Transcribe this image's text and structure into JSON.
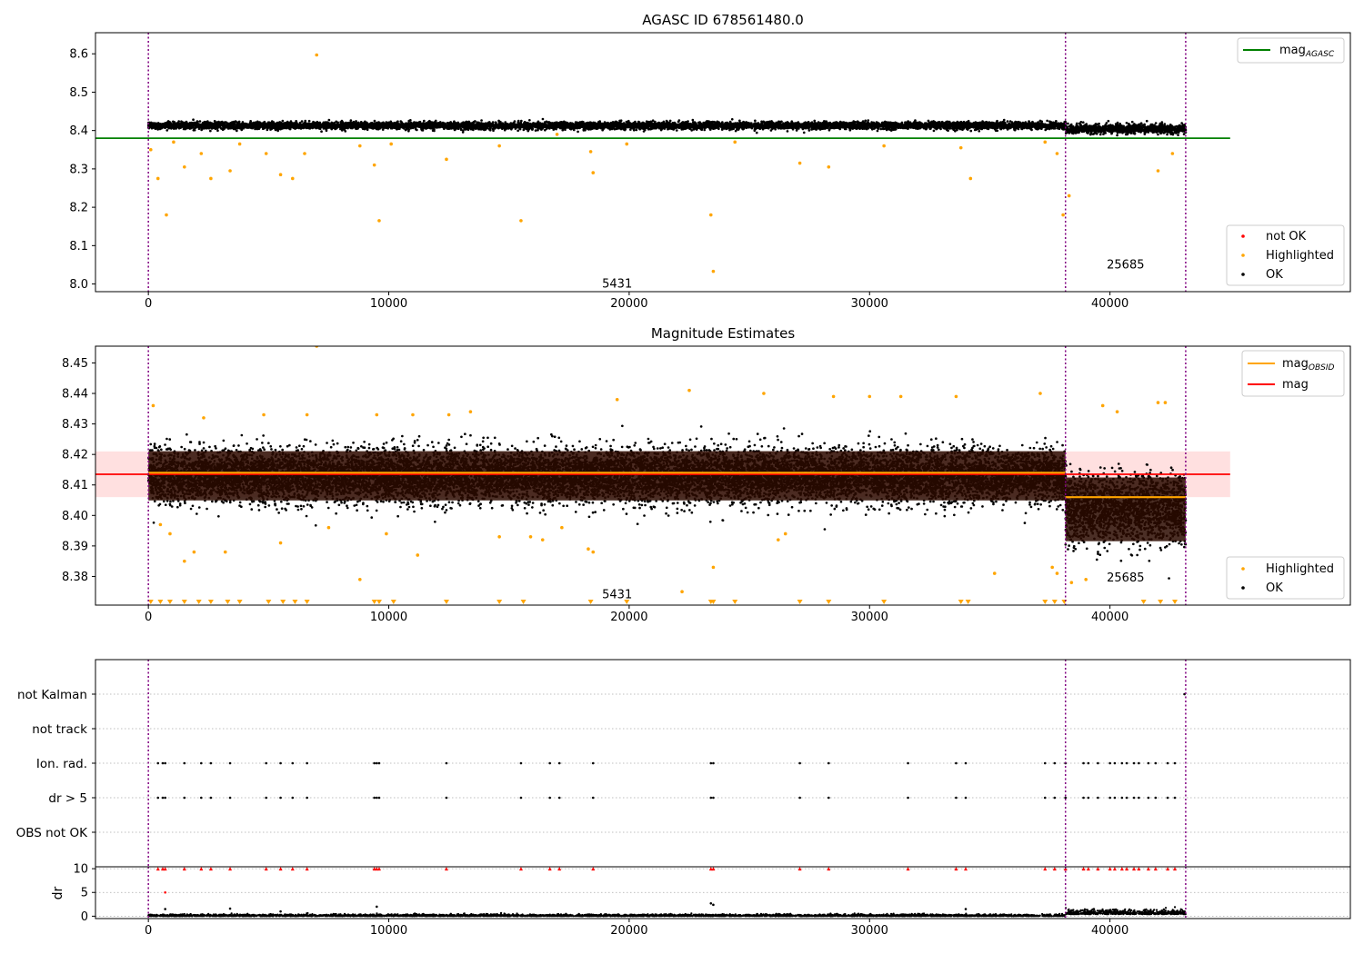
{
  "figure": {
    "x_ticks": [
      "0",
      "10000",
      "20000",
      "30000",
      "40000"
    ]
  },
  "chart_data": [
    {
      "type": "scatter",
      "title": "AGASC ID 678561480.0",
      "xlim": [
        -2200,
        50000
      ],
      "ylim": [
        7.98,
        8.655
      ],
      "y_ticks": [
        "8.0",
        "8.1",
        "8.2",
        "8.3",
        "8.4",
        "8.5",
        "8.6"
      ],
      "vlines": [
        0,
        38150,
        43150
      ],
      "segment_labels": [
        {
          "text": "5431",
          "x": 19500,
          "y": 8.0
        },
        {
          "text": "25685",
          "x": 40650,
          "y": 8.05
        }
      ],
      "mag_agasc": 8.38,
      "mag_agasc_xrange": [
        -2200,
        45000
      ],
      "band": {
        "segments": [
          {
            "x0": 0,
            "x1": 38150,
            "y_mean": 8.413,
            "spread": 0.009
          },
          {
            "x0": 38150,
            "x1": 43150,
            "y_mean": 8.404,
            "spread": 0.011
          }
        ]
      },
      "highlighted": [
        [
          100,
          8.35
        ],
        [
          400,
          8.275
        ],
        [
          750,
          8.18
        ],
        [
          1050,
          8.37
        ],
        [
          1500,
          8.305
        ],
        [
          2200,
          8.34
        ],
        [
          2600,
          8.275
        ],
        [
          3400,
          8.295
        ],
        [
          3800,
          8.365
        ],
        [
          4900,
          8.34
        ],
        [
          5500,
          8.285
        ],
        [
          6000,
          8.275
        ],
        [
          6500,
          8.34
        ],
        [
          7000,
          8.597
        ],
        [
          8800,
          8.36
        ],
        [
          9400,
          8.31
        ],
        [
          9600,
          8.165
        ],
        [
          10100,
          8.365
        ],
        [
          12400,
          8.325
        ],
        [
          14600,
          8.36
        ],
        [
          15500,
          8.165
        ],
        [
          17000,
          8.39
        ],
        [
          18400,
          8.345
        ],
        [
          18500,
          8.29
        ],
        [
          19900,
          8.365
        ],
        [
          23400,
          8.18
        ],
        [
          23500,
          8.033
        ],
        [
          24400,
          8.37
        ],
        [
          27100,
          8.315
        ],
        [
          28300,
          8.305
        ],
        [
          30600,
          8.36
        ],
        [
          33800,
          8.355
        ],
        [
          34200,
          8.275
        ],
        [
          37300,
          8.37
        ],
        [
          37800,
          8.34
        ],
        [
          38050,
          8.18
        ],
        [
          38300,
          8.23
        ],
        [
          42000,
          8.295
        ],
        [
          42600,
          8.34
        ]
      ],
      "legend_lines": [
        {
          "label": "mag",
          "sub": "AGASC",
          "color": "#008000"
        }
      ],
      "legend_points": [
        {
          "label": "not OK",
          "color": "#ff0000"
        },
        {
          "label": "Highlighted",
          "color": "#ffa500"
        },
        {
          "label": "OK",
          "color": "#000000"
        }
      ]
    },
    {
      "type": "scatter",
      "title": "Magnitude Estimates",
      "xlim": [
        -2200,
        50000
      ],
      "ylim": [
        8.3706,
        8.4555
      ],
      "y_ticks": [
        "8.38",
        "8.39",
        "8.40",
        "8.41",
        "8.42",
        "8.43",
        "8.44",
        "8.45"
      ],
      "vlines": [
        0,
        38150,
        43150
      ],
      "segment_labels": [
        {
          "text": "5431",
          "x": 19500,
          "y": 8.374
        },
        {
          "text": "25685",
          "x": 40650,
          "y": 8.3795
        }
      ],
      "mag": 8.4135,
      "mag_band": [
        8.406,
        8.421
      ],
      "mag_xrange": [
        -2200,
        45000
      ],
      "mag_obsid": [
        {
          "x0": 0,
          "x1": 38150,
          "y": 8.414
        },
        {
          "x0": 38150,
          "x1": 43150,
          "y": 8.406
        }
      ],
      "band": {
        "segments": [
          {
            "x0": 0,
            "x1": 38150,
            "y_mean": 8.413,
            "spread": 0.0085
          },
          {
            "x0": 38150,
            "x1": 43150,
            "y_mean": 8.402,
            "spread": 0.011
          }
        ]
      },
      "highlighted": [
        [
          200,
          8.436
        ],
        [
          500,
          8.397
        ],
        [
          900,
          8.394
        ],
        [
          1500,
          8.385
        ],
        [
          1900,
          8.388
        ],
        [
          2300,
          8.432
        ],
        [
          3200,
          8.388
        ],
        [
          4800,
          8.433
        ],
        [
          5500,
          8.391
        ],
        [
          6600,
          8.433
        ],
        [
          7000,
          8.4555
        ],
        [
          7500,
          8.396
        ],
        [
          8800,
          8.379
        ],
        [
          9500,
          8.433
        ],
        [
          9900,
          8.394
        ],
        [
          11000,
          8.433
        ],
        [
          11200,
          8.387
        ],
        [
          12500,
          8.433
        ],
        [
          13400,
          8.434
        ],
        [
          14600,
          8.393
        ],
        [
          15900,
          8.393
        ],
        [
          16400,
          8.392
        ],
        [
          17200,
          8.396
        ],
        [
          18300,
          8.389
        ],
        [
          18500,
          8.388
        ],
        [
          19500,
          8.438
        ],
        [
          22200,
          8.375
        ],
        [
          22500,
          8.441
        ],
        [
          23500,
          8.383
        ],
        [
          25600,
          8.44
        ],
        [
          26200,
          8.392
        ],
        [
          26500,
          8.394
        ],
        [
          28500,
          8.439
        ],
        [
          30000,
          8.439
        ],
        [
          31300,
          8.439
        ],
        [
          33600,
          8.439
        ],
        [
          35200,
          8.381
        ],
        [
          37100,
          8.44
        ],
        [
          37600,
          8.383
        ],
        [
          37800,
          8.381
        ],
        [
          38400,
          8.378
        ],
        [
          39000,
          8.379
        ],
        [
          39700,
          8.436
        ],
        [
          40300,
          8.434
        ],
        [
          42000,
          8.437
        ],
        [
          42300,
          8.437
        ]
      ],
      "off_scale_low": [
        100,
        500,
        900,
        1500,
        2100,
        2600,
        3300,
        3800,
        5000,
        5600,
        6100,
        6600,
        9400,
        9600,
        10200,
        12400,
        14600,
        15600,
        18400,
        19900,
        23400,
        23500,
        24400,
        27100,
        28300,
        30600,
        33800,
        34100,
        37300,
        37700,
        38100,
        41400,
        42100,
        42700
      ],
      "legend_lines": [
        {
          "label": "mag",
          "sub": "OBSID",
          "color": "#ffa500"
        },
        {
          "label": "mag",
          "sub": "",
          "color": "#ff0000"
        }
      ],
      "legend_points": [
        {
          "label": "Highlighted",
          "color": "#ffa500"
        },
        {
          "label": "OK",
          "color": "#000000"
        }
      ]
    },
    {
      "type": "scatter",
      "title": "",
      "xlim": [
        -2200,
        50000
      ],
      "categories": [
        "not Kalman",
        "not track",
        "Ion. rad.",
        "dr > 5",
        "OBS not OK"
      ],
      "vlines": [
        0,
        38150,
        43150
      ],
      "flag_x": [
        400,
        600,
        700,
        1500,
        2200,
        2600,
        3400,
        4900,
        5500,
        6000,
        6600,
        9400,
        9500,
        9600,
        12400,
        15500,
        16700,
        17100,
        18500,
        23400,
        23500,
        27100,
        28300,
        31600,
        33600,
        34000,
        37300,
        37700,
        38150,
        38900,
        39100,
        39500,
        40000,
        40200,
        40500,
        40700,
        41000,
        41200,
        41600,
        41900,
        42400,
        42700
      ],
      "flag_rows": {
        "not Kalman": [
          43100
        ],
        "Ion. rad.": "flag_x",
        "dr > 5": "flag_x"
      }
    },
    {
      "type": "scatter",
      "title": "",
      "xlim": [
        -2200,
        50000
      ],
      "ylim": [
        -0.5,
        10.4
      ],
      "ylabel": "dr",
      "y_ticks": [
        "0",
        "5",
        "10"
      ],
      "vlines": [
        0,
        38150,
        43150
      ],
      "dr_capped_value": 10,
      "dr_outliers": [
        [
          700,
          5.0
        ],
        [
          700,
          1.5
        ],
        [
          3400,
          1.6
        ],
        [
          5500,
          1.0
        ],
        [
          9500,
          2.0
        ],
        [
          23400,
          2.7
        ],
        [
          23500,
          2.4
        ],
        [
          34000,
          1.5
        ]
      ]
    }
  ]
}
